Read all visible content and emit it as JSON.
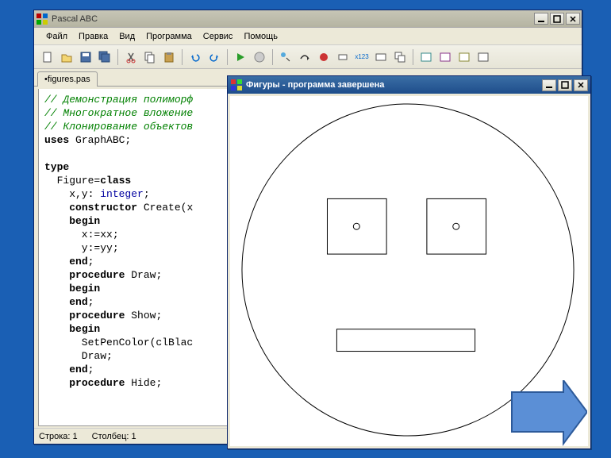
{
  "main_window": {
    "title": "Pascal ABC",
    "menu": [
      "Файл",
      "Правка",
      "Вид",
      "Программа",
      "Сервис",
      "Помощь"
    ],
    "tab": "•figures.pas",
    "status": {
      "line_label": "Строка:",
      "line_val": "1",
      "col_label": "Столбец:",
      "col_val": "1"
    }
  },
  "code": {
    "c1": "// Демонстрация полиморф",
    "c2": "// Многократное вложение",
    "c3": "// Клонирование объектов",
    "uses": "uses",
    "uses_v": " GraphABC;",
    "type": "type",
    "figcls": "  Figure=",
    "cls": "class",
    "xy": "    x,y: ",
    "int": "integer",
    "semi": ";",
    "ctor": "    ",
    "ctork": "constructor",
    "ctorv": " Create(x",
    "begin": "begin",
    "xx": "      x:=xx;",
    "yy": "      y:=yy;",
    "end": "end",
    "endsemi": ";",
    "proc": "procedure",
    "draw": " Draw;",
    "show": " Show;",
    "hide": " Hide;",
    "setpen": "      SetPenColor(clBlac",
    "drawcall": "      Draw;"
  },
  "gfx_window": {
    "title": "Фигуры - программа завершена"
  },
  "icons": {
    "new": "new-icon",
    "open": "open-icon",
    "save": "save-icon",
    "saveall": "saveall-icon",
    "cut": "cut-icon",
    "copy": "copy-icon",
    "paste": "paste-icon",
    "undo": "undo-icon",
    "redo": "redo-icon",
    "run": "run-icon",
    "stop": "stop-icon",
    "debug": "debug-icon",
    "step": "step-icon",
    "brk": "breakpoint-icon",
    "watch": "watch-icon",
    "eval": "eval-icon",
    "x123": "variables-icon",
    "win1": "win-icon",
    "win2": "win-icon",
    "out": "output-icon",
    "msg": "messages-icon",
    "tool": "tool-icon",
    "help": "help-icon"
  }
}
